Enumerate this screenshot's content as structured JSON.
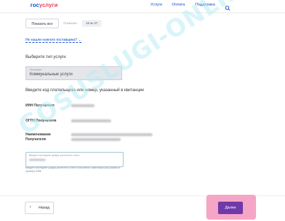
{
  "header": {
    "logo_part1": "гос",
    "logo_part2": "услуги",
    "nav": [
      "Услуги",
      "Оплата",
      "Поддержка"
    ]
  },
  "toolbar": {
    "show_all_label": "Показать все",
    "shown_label": "Показано",
    "shown_value": "18 из 27"
  },
  "link_not_found": "Не нашли нужного поставщика?",
  "service_section": {
    "title": "Выберите тип услуги",
    "select_label": "Тип услуги",
    "select_value": "Коммунальные услуги"
  },
  "payer_section": {
    "title": "Введите код плательщика или номер, указанный в квитанции",
    "inn_label": "ИНН Получателя",
    "ogrn_label": "ОГРН Получателя",
    "name_label_line1": "Наименование",
    "name_label_line2": "Получателя",
    "input_placeholder": "Введите последние цифры расчетного счета",
    "hint": "Введите последние цифры расчетного счета Получателя с квитанции (как указано в примере 8386"
  },
  "footer": {
    "back_label": "Назад",
    "next_label": "Далее"
  },
  "watermark": "GOSUSLUGI-ONLINE.RU",
  "colors": {
    "brand_blue": "#0d4cd3",
    "brand_red": "#ee3f58",
    "next_button": "#6e3aa8",
    "highlight": "#f5a6c6"
  }
}
